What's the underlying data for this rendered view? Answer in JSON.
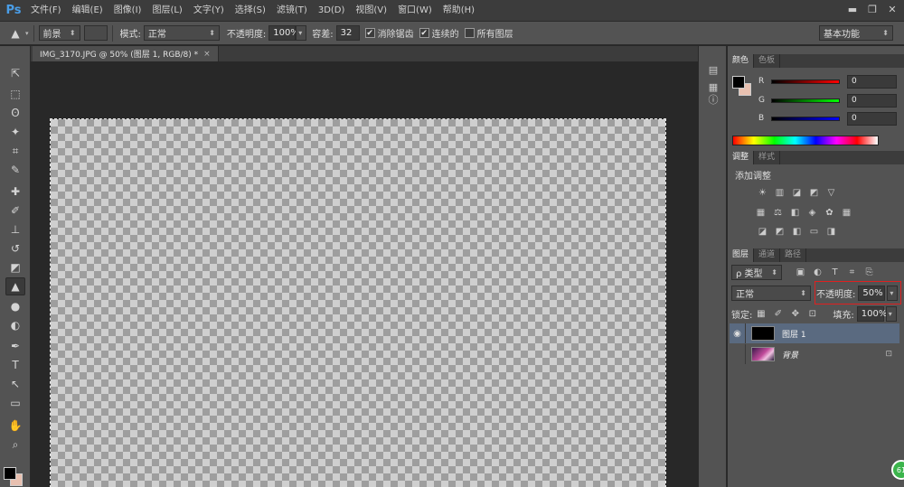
{
  "app": {
    "logo": "Ps"
  },
  "menu": [
    "文件(F)",
    "编辑(E)",
    "图像(I)",
    "图层(L)",
    "文字(Y)",
    "选择(S)",
    "滤镜(T)",
    "3D(D)",
    "视图(V)",
    "窗口(W)",
    "帮助(H)"
  ],
  "window_controls": {
    "minimize": "▬",
    "restore": "❐",
    "close": "✕"
  },
  "options": {
    "fill_source": "前景",
    "mode_label": "模式:",
    "mode_value": "正常",
    "opacity_label": "不透明度:",
    "opacity_value": "100%",
    "tolerance_label": "容差:",
    "tolerance_value": "32",
    "antialias_label": "消除锯齿",
    "antialias_checked": true,
    "contiguous_label": "连续的",
    "contiguous_checked": true,
    "all_layers_label": "所有图层",
    "all_layers_checked": false,
    "workspace": "基本功能"
  },
  "document": {
    "tab_title": "IMG_3170.JPG @ 50% (图层 1, RGB/8) *",
    "close": "×"
  },
  "tools": [
    "move-icon",
    "marquee-icon",
    "lasso-icon",
    "magic-wand-icon",
    "crop-icon",
    "eyedropper-icon",
    "healing-brush-icon",
    "brush-icon",
    "clone-stamp-icon",
    "history-brush-icon",
    "eraser-icon",
    "paint-bucket-icon",
    "blur-icon",
    "dodge-icon",
    "pen-icon",
    "type-icon",
    "path-selection-icon",
    "rectangle-icon",
    "hand-icon",
    "zoom-icon"
  ],
  "tool_glyphs": [
    "⇱",
    "⬚",
    "ʘ",
    "✦",
    "⌗",
    "✎",
    "✚",
    "✐",
    "⊥",
    "↺",
    "◩",
    "▲",
    "●",
    "◐",
    "✒",
    "T",
    "↖",
    "▭",
    "✋",
    "⌕"
  ],
  "colors": {
    "foreground": "#000000",
    "background": "#e8c0b0"
  },
  "panels": {
    "color_tabs": [
      "颜色",
      "色板"
    ],
    "color_channels": [
      {
        "name": "R",
        "value": "0"
      },
      {
        "name": "G",
        "value": "0"
      },
      {
        "name": "B",
        "value": "0"
      }
    ],
    "adjust_tabs": [
      "调整",
      "样式"
    ],
    "adjust_title": "添加调整",
    "layers_tabs": [
      "图层",
      "通道",
      "路径"
    ],
    "layer_filter": "ρ 类型",
    "blend_mode": "正常",
    "opacity_label": "不透明度:",
    "opacity_value": "50%",
    "lock_label": "锁定:",
    "fill_label": "填充:",
    "fill_value": "100%",
    "layers": [
      {
        "name": "图层 1",
        "visible": true,
        "selected": true
      },
      {
        "name": "背景",
        "visible": false,
        "selected": false,
        "locked": true
      }
    ]
  },
  "badge": "61"
}
